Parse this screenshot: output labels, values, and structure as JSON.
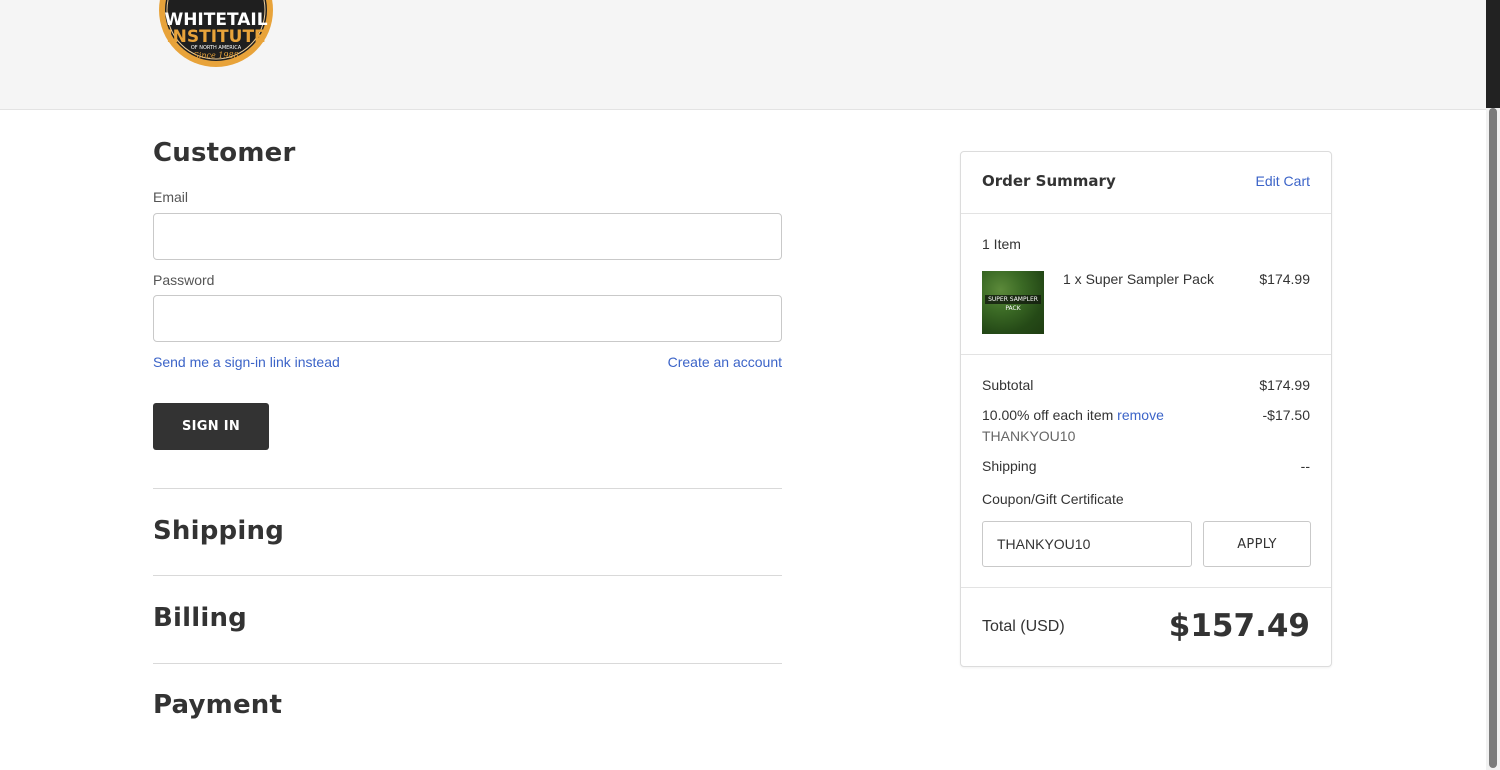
{
  "header": {
    "logo": {
      "line1": "WHITETAIL",
      "line2": "INSTITUTE",
      "line3": "OF NORTH AMERICA",
      "line4": "Since 1988"
    }
  },
  "customer": {
    "title": "Customer",
    "email_label": "Email",
    "email_value": "",
    "password_label": "Password",
    "password_value": "",
    "signin_link": "Send me a sign-in link instead",
    "create_account_link": "Create an account",
    "signin_button": "SIGN IN"
  },
  "sections": {
    "shipping": "Shipping",
    "billing": "Billing",
    "payment": "Payment"
  },
  "order_summary": {
    "title": "Order Summary",
    "edit_cart": "Edit Cart",
    "item_count": "1 Item",
    "items": [
      {
        "name": "1 x Super Sampler Pack",
        "price": "$174.99",
        "thumb_text": "SUPER SAMPLER PACK"
      }
    ],
    "subtotal_label": "Subtotal",
    "subtotal_value": "$174.99",
    "discount_label": "10.00% off each item",
    "discount_remove": "remove",
    "discount_value": "-$17.50",
    "coupon_code": "THANKYOU10",
    "shipping_label": "Shipping",
    "shipping_value": "--",
    "coupon_label": "Coupon/Gift Certificate",
    "coupon_input_value": "THANKYOU10",
    "apply_button": "APPLY",
    "total_label": "Total (USD)",
    "total_value": "$157.49"
  },
  "colors": {
    "link": "#3c64c8",
    "button_dark": "#333333",
    "logo_orange": "#e8a33a",
    "logo_dark": "#1f1f1f"
  }
}
